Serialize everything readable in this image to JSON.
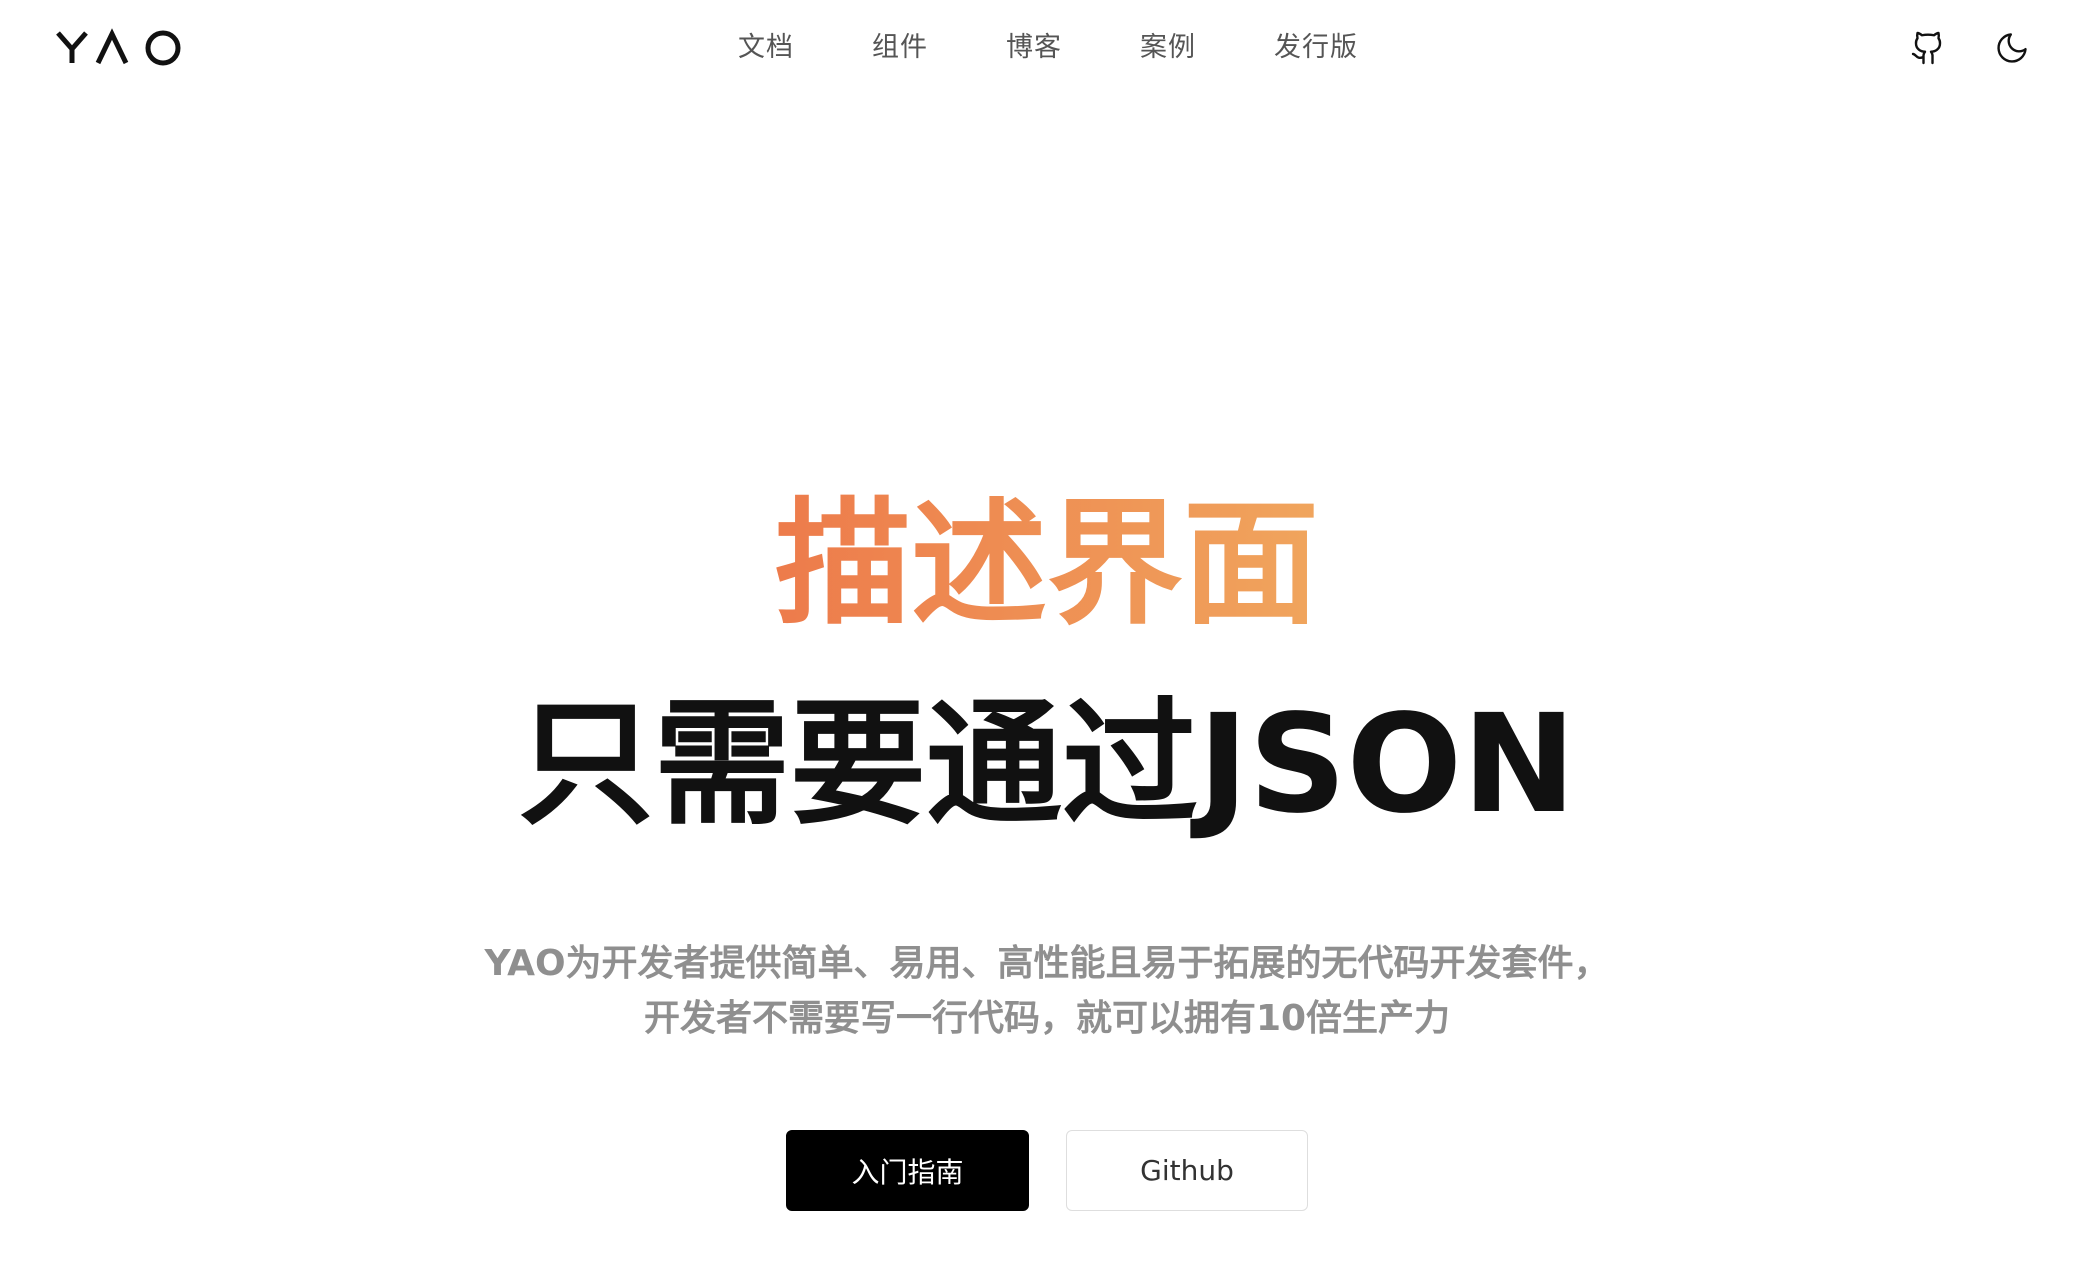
{
  "brand": {
    "logo_text": "YAO"
  },
  "nav": {
    "items": [
      {
        "label": "文档"
      },
      {
        "label": "组件"
      },
      {
        "label": "博客"
      },
      {
        "label": "案例"
      },
      {
        "label": "发行版"
      }
    ]
  },
  "header_actions": {
    "github_icon": "github-icon",
    "theme_icon": "moon-icon"
  },
  "hero": {
    "title_line1": "描述界面",
    "title_line2": "只需要通过JSON",
    "subtitle_line1": "YAO为开发者提供简单、易用、高性能且易于拓展的无代码开发套件，",
    "subtitle_line2": "开发者不需要写一行代码，就可以拥有10倍生产力",
    "gradient_start": "#ed7b4b",
    "gradient_end": "#f0a55d"
  },
  "buttons": {
    "primary_label": "入门指南",
    "secondary_label": "Github"
  }
}
